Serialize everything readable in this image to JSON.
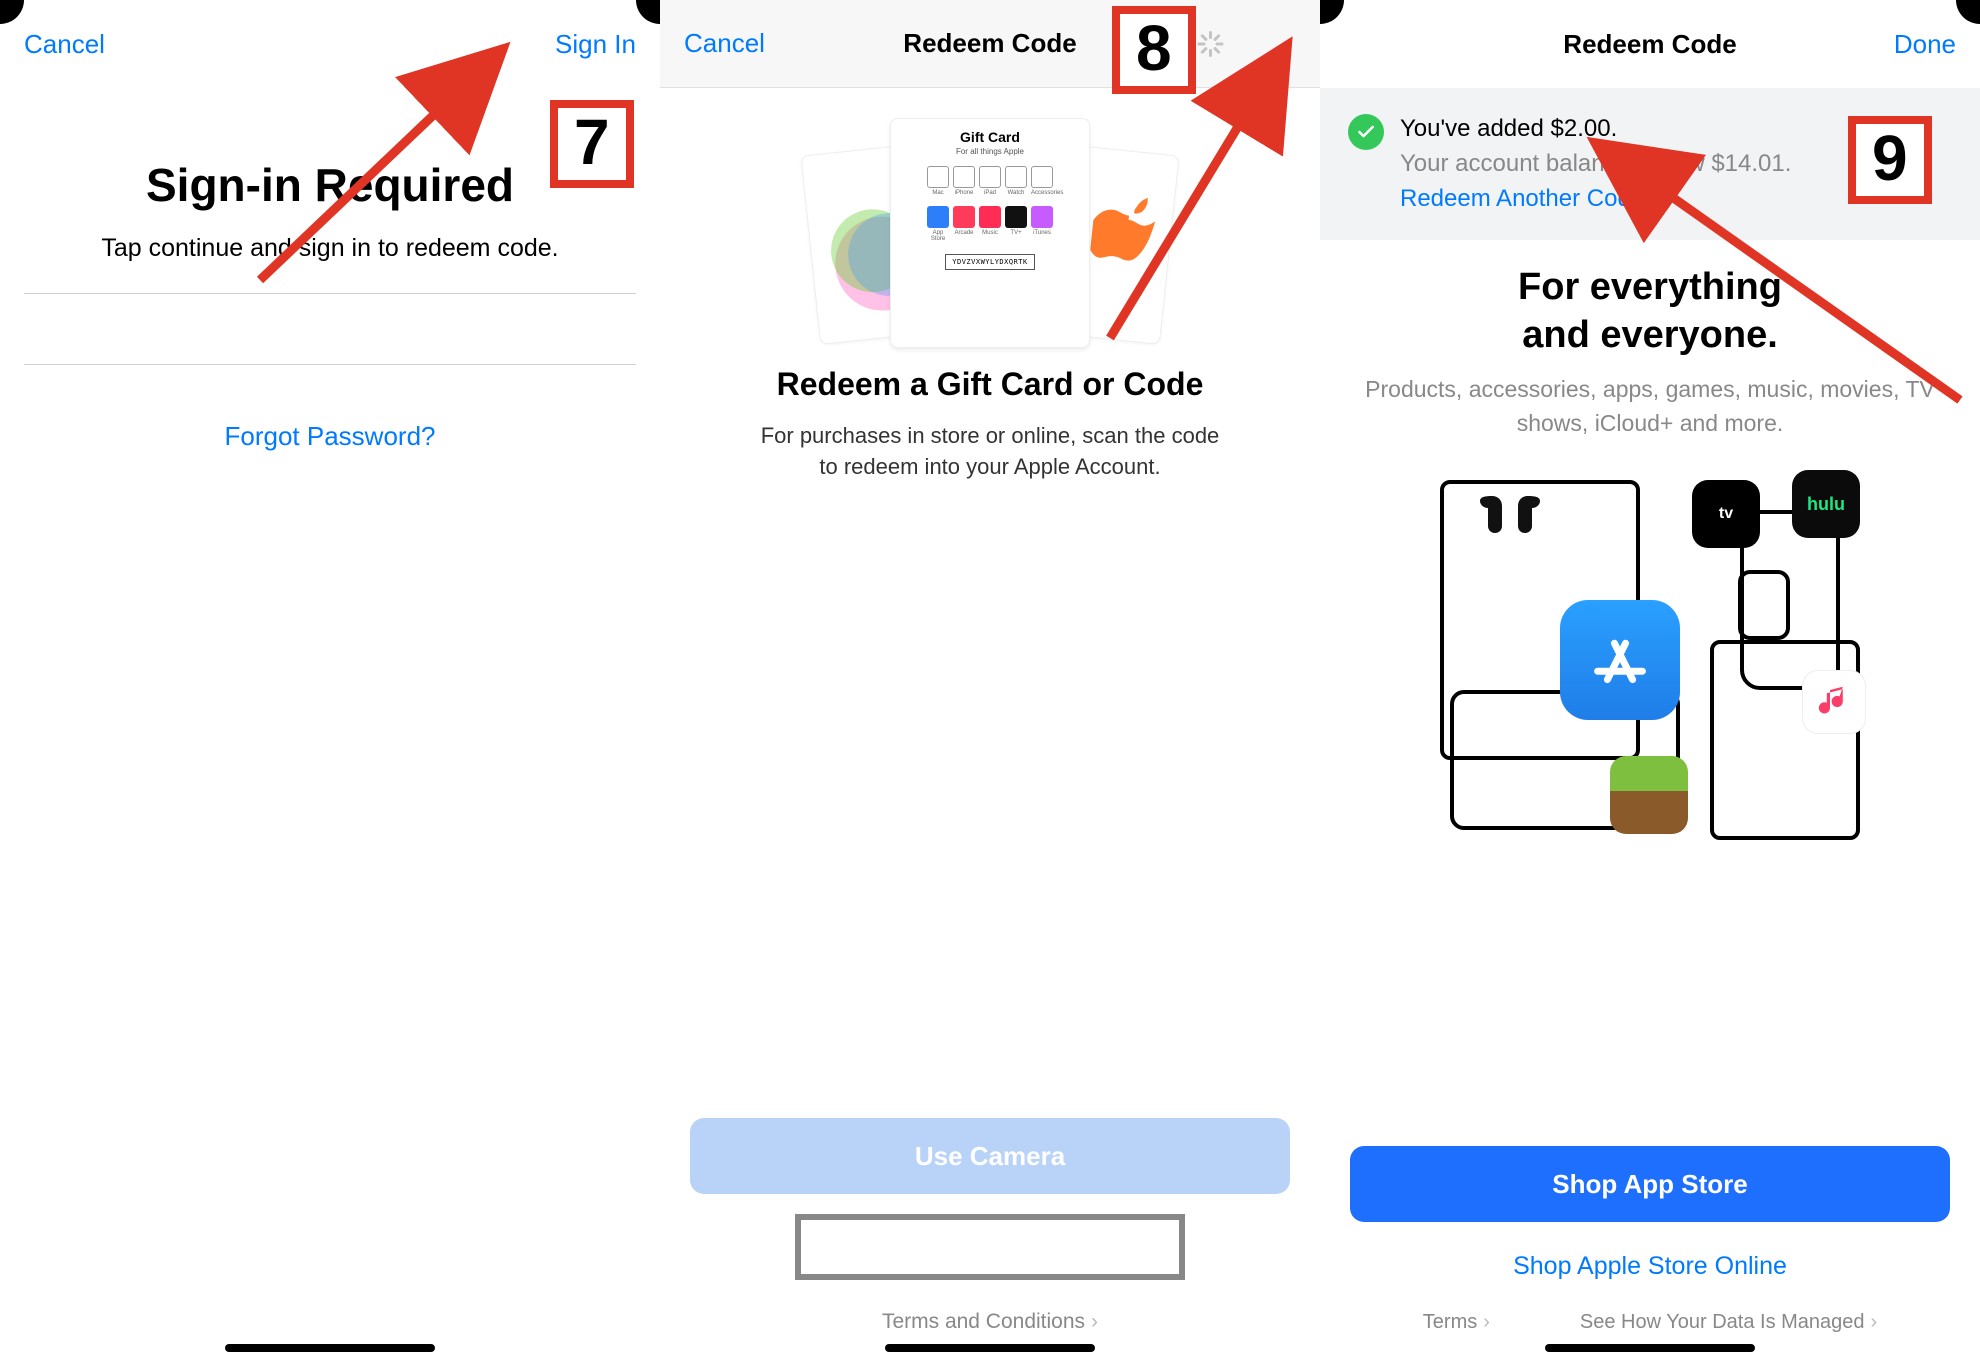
{
  "pane1": {
    "nav": {
      "cancel": "Cancel",
      "signin": "Sign In"
    },
    "title": "Sign-in Required",
    "subtitle": "Tap continue and sign in to redeem code.",
    "forgot": "Forgot Password?",
    "step": "7"
  },
  "pane2": {
    "nav": {
      "cancel": "Cancel",
      "title": "Redeem Code"
    },
    "giftcard": {
      "title": "Gift Card",
      "subtitle": "For all things Apple",
      "row1_labels": [
        "Mac",
        "iPhone",
        "iPad",
        "Watch",
        "Accessories"
      ],
      "row2_labels": [
        "App Store",
        "Arcade",
        "Music",
        "TV+",
        "iTunes"
      ],
      "code_sample": "YDVZVXWYLYDXQRTK"
    },
    "heading": "Redeem a Gift Card or Code",
    "desc": "For purchases in store or online, scan the code to redeem into your Apple Account.",
    "use_camera": "Use Camera",
    "terms": "Terms and Conditions",
    "step": "8"
  },
  "pane3": {
    "nav": {
      "title": "Redeem Code",
      "done": "Done"
    },
    "banner": {
      "added": "You've added $2.00.",
      "balance": "Your account balance is now $14.01.",
      "redeem_another": "Redeem Another Code"
    },
    "hero": {
      "title_line1": "For everything",
      "title_line2": "and everyone.",
      "subtitle": "Products, accessories, apps, games, music, movies, TV shows, iCloud+ and more."
    },
    "icons": {
      "tv": "tv",
      "hulu": "hulu"
    },
    "shop_button": "Shop App Store",
    "shop_online": "Shop Apple Store Online",
    "terms": "Terms",
    "data_managed": "See How Your Data Is Managed",
    "step": "9"
  }
}
